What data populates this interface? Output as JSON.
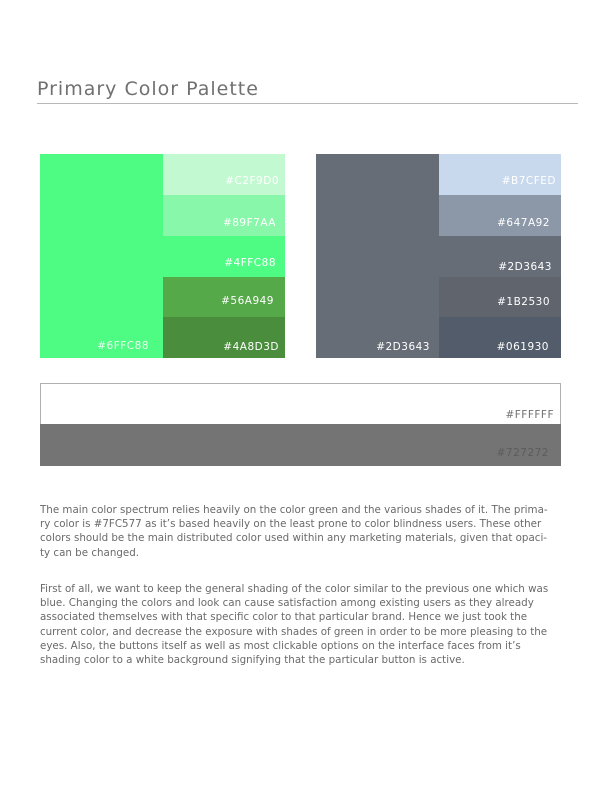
{
  "page": {
    "title": "Primary Color Palette"
  },
  "green_palette": {
    "main": {
      "hex": "#6FFC88",
      "label": "#6FFC88",
      "color": "#4ffc83"
    },
    "shades": [
      {
        "label": "#C2F9D0",
        "color": "#c2f9d0"
      },
      {
        "label": "#89F7AA",
        "color": "#89f7aa"
      },
      {
        "label": "#4FFC88",
        "color": "#4ffc83"
      },
      {
        "label": "#56A949",
        "color": "#56a949"
      },
      {
        "label": "#4A8D3D",
        "color": "#4a8d3d"
      }
    ]
  },
  "gray_palette": {
    "main": {
      "label": "#2D3643",
      "color": "#676d77"
    },
    "shades": [
      {
        "label": "#B7CFED",
        "color": "#c8d9ee"
      },
      {
        "label": "#647A92",
        "color": "#8c98a8"
      },
      {
        "label": "#2D3643",
        "color": "#676d77"
      },
      {
        "label": "#1B2530",
        "color": "#5f646d"
      },
      {
        "label": "#061930",
        "color": "#535c6a"
      }
    ]
  },
  "neutral_palette": {
    "white": {
      "label": "#FFFFFF",
      "color": "#ffffff"
    },
    "gray": {
      "label": "#727272",
      "color": "#747474"
    }
  },
  "body": {
    "paragraph_1": "The main color spectrum relies heavily on the color green and the various shades of it. The prima-\nry color is #7FC577 as it’s based heavily on the least prone to color blindness users. These other\ncolors should be the main distributed color used within any marketing materials, given that opaci-\nty can be changed.",
    "paragraph_2": "First of all, we want to keep the general shading of the color similar to the previous one which was\nblue. Changing the colors and look can cause satisfaction among existing users as they already\nassociated themselves with that specific color to that particular brand.  Hence we just took the\ncurrent color, and decrease the exposure with shades of green in order to be more pleasing to the\neyes.  Also, the buttons itself as well as most clickable options on the interface faces from it’s\nshading color to a white background signifying that the particular button is active."
  }
}
